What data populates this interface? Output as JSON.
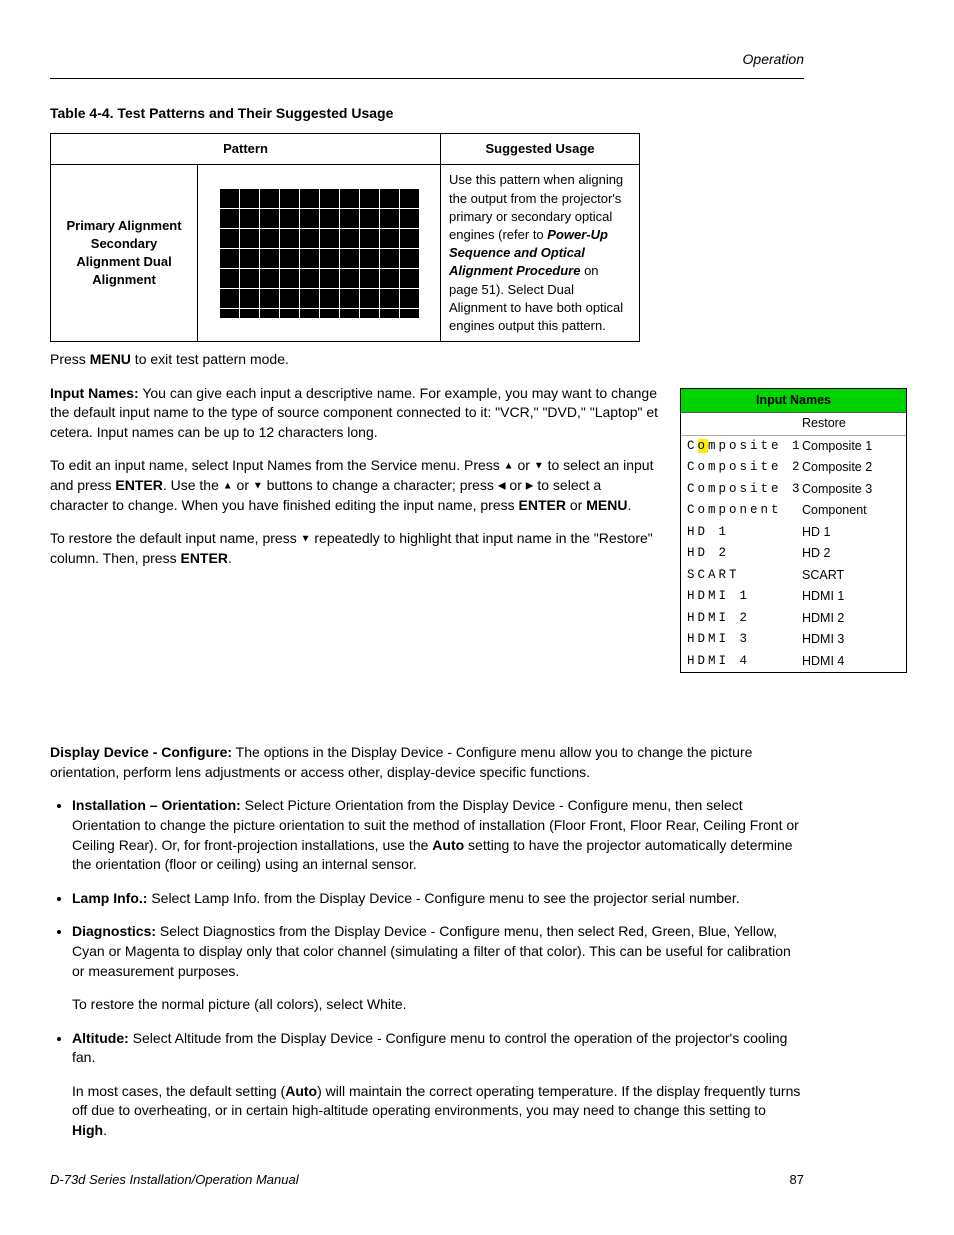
{
  "header": {
    "section": "Operation"
  },
  "table": {
    "title": "Table 4-4. Test Patterns and Their Suggested Usage",
    "col1": "Pattern",
    "col2": "Suggested Usage",
    "row_label": "Primary Alignment Secondary Alignment Dual Alignment",
    "usage_pre": "Use this pattern when aligning the output from the projector's primary or secondary optical engines (refer to ",
    "usage_bold": "Power-Up Sequence and Optical Alignment Procedure",
    "usage_post": " on page 51). Select Dual Alignment to have both optical engines output this pattern."
  },
  "body": {
    "exit_pre": "Press ",
    "exit_bold": "MENU",
    "exit_post": " to exit test pattern mode.",
    "input_names_bold": "Input Names:",
    "input_names_text": " You can give each input a descriptive name. For example, you may want to change the default input name to the type of source component connected to it: \"VCR,\" \"DVD,\" \"Laptop\" et cetera. Input names can be up to 12 characters long.",
    "edit_p1_pre": "To edit an input name, select Input Names from the Service menu. Press ",
    "edit_p1_mid": " or ",
    "edit_p1_post": " to select an input and press ",
    "enter": "ENTER",
    "edit_p2_pre": ". Use the ",
    "edit_p2_mid": " or ",
    "edit_p2_post": " buttons to change a character; press ",
    "edit_p3_mid": " or ",
    "edit_p3_post": " to select a character to change. When you have finished editing the input name, press ",
    "or": " or ",
    "menu": "MENU",
    "period": ".",
    "restore_pre": "To restore the default input name, press ",
    "restore_post": " repeatedly to highlight that input name in the \"Restore\" column. Then, press ",
    "display_bold": "Display Device - Configure:",
    "display_text": " The options in the Display Device - Configure menu allow you to change the picture orientation, perform lens adjustments or access other, display-device specific functions.",
    "b1_bold": "Installation – Orientation:",
    "b1_text_pre": " Select Picture Orientation from the Display Device - Configure menu, then select Orientation to change the picture orientation to suit the method of installation (Floor Front, Floor Rear, Ceiling Front or Ceiling Rear). Or, for front-projection installations, use the ",
    "b1_auto": "Auto",
    "b1_text_post": " setting to have the projector automatically determine the orientation (floor or ceiling) using an internal sensor.",
    "b2_bold": "Lamp Info.:",
    "b2_text": " Select Lamp Info. from the Display Device - Configure menu to see the projector serial number.",
    "b3_bold": "Diagnostics:",
    "b3_text": " Select Diagnostics from the Display Device - Configure menu, then select Red, Green, Blue, Yellow, Cyan or Magenta to display only that color channel (simulating a filter of that color). This can be useful for calibration or measurement purposes.",
    "b3_p2": "To restore the normal picture (all colors), select White.",
    "b4_bold": "Altitude:",
    "b4_text": " Select Altitude from the Display Device - Configure menu to control the operation of the projector's cooling fan.",
    "b4_p2_pre": "In most cases, the default setting (",
    "b4_auto": "Auto",
    "b4_p2_mid": ") will maintain the correct operating temperature. If the display frequently turns off due to overheating, or in certain high-altitude operating environments, you may need to change this setting to ",
    "b4_high": "High",
    "b4_p2_post": "."
  },
  "input_box": {
    "title": "Input Names",
    "restore": "Restore",
    "rows": [
      {
        "l_pre": "C",
        "l_hl": "o",
        "l_post": "mposite 1",
        "r": "Composite 1"
      },
      {
        "l_pre": "",
        "l_hl": "",
        "l_post": "Composite 2",
        "r": "Composite 2"
      },
      {
        "l_pre": "",
        "l_hl": "",
        "l_post": "Composite 3",
        "r": "Composite 3"
      },
      {
        "l_pre": "",
        "l_hl": "",
        "l_post": "Component",
        "r": "Component"
      },
      {
        "l_pre": "",
        "l_hl": "",
        "l_post": "HD 1",
        "r": "HD 1"
      },
      {
        "l_pre": "",
        "l_hl": "",
        "l_post": "HD 2",
        "r": "HD 2"
      },
      {
        "l_pre": "",
        "l_hl": "",
        "l_post": "SCART",
        "r": "SCART"
      },
      {
        "l_pre": "",
        "l_hl": "",
        "l_post": "HDMI 1",
        "r": "HDMI 1"
      },
      {
        "l_pre": "",
        "l_hl": "",
        "l_post": "HDMI 2",
        "r": "HDMI 2"
      },
      {
        "l_pre": "",
        "l_hl": "",
        "l_post": "HDMI 3",
        "r": "HDMI 3"
      },
      {
        "l_pre": "",
        "l_hl": "",
        "l_post": "HDMI 4",
        "r": "HDMI 4"
      }
    ]
  },
  "footer": {
    "title": "D-73d Series Installation/Operation Manual",
    "page": "87"
  }
}
